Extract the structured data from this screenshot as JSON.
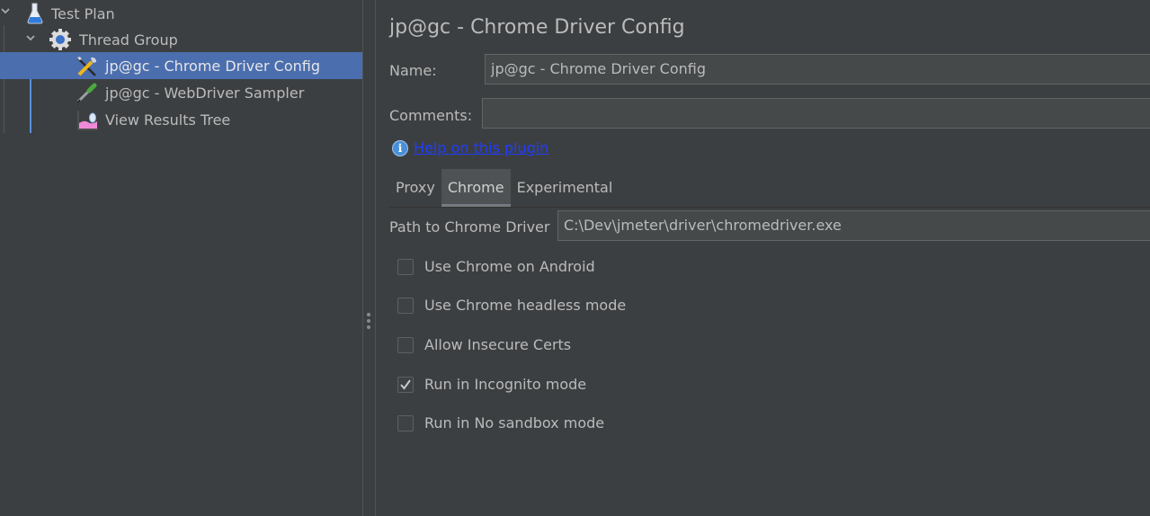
{
  "tree": {
    "items": [
      {
        "label": "Test Plan",
        "icon": "flask-icon",
        "expanded": true,
        "selected": false
      },
      {
        "label": "Thread Group",
        "icon": "gear-icon",
        "expanded": true,
        "selected": false
      },
      {
        "label": "jp@gc - Chrome Driver Config",
        "icon": "tools-icon",
        "selected": true
      },
      {
        "label": "jp@gc - WebDriver Sampler",
        "icon": "pipette-icon",
        "selected": false
      },
      {
        "label": "View Results Tree",
        "icon": "results-tree-icon",
        "selected": false
      }
    ]
  },
  "editor": {
    "title": "jp@gc - Chrome Driver Config",
    "name_label": "Name:",
    "name_value": "jp@gc - Chrome Driver Config",
    "comments_label": "Comments:",
    "comments_value": "",
    "help_link": "Help on this plugin",
    "tabs": [
      {
        "label": "Proxy",
        "active": false
      },
      {
        "label": "Chrome",
        "active": true
      },
      {
        "label": "Experimental",
        "active": false
      }
    ],
    "path_label": "Path to Chrome Driver",
    "path_value": "C:\\Dev\\jmeter\\driver\\chromedriver.exe",
    "checkboxes": [
      {
        "label": "Use Chrome on Android",
        "checked": false
      },
      {
        "label": "Use Chrome headless mode",
        "checked": false
      },
      {
        "label": "Allow Insecure Certs",
        "checked": false
      },
      {
        "label": "Run in Incognito mode",
        "checked": true
      },
      {
        "label": "Run in No sandbox mode",
        "checked": false
      }
    ]
  },
  "colors": {
    "background": "#3c3f41",
    "selection": "#4b6eaf",
    "link": "#1f3dff",
    "field_bg": "#45494a"
  }
}
